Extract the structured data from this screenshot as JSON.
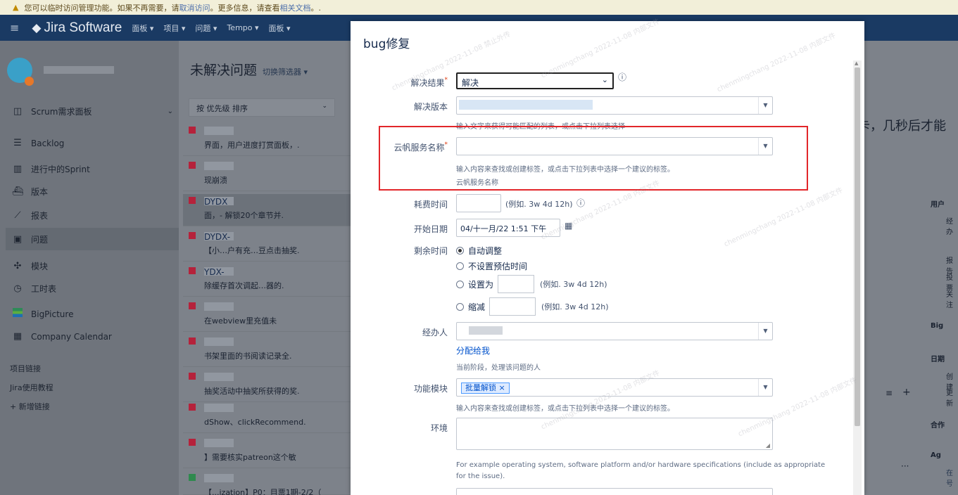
{
  "banner": {
    "text_before": "您可以临时访问管理功能。如果不再需要，请 ",
    "cancel_link": "取消访问",
    "text_middle": "。更多信息，请查看 ",
    "docs_link": "相关文档",
    "text_after": "。."
  },
  "topnav": {
    "app_name": "Jira Software",
    "items": [
      "面板 ▾",
      "项目 ▾",
      "问题 ▾",
      "Tempo ▾",
      "面板 ▾"
    ]
  },
  "sidebar": {
    "board_name": "Scrum需求面板",
    "items": [
      {
        "label": "Backlog",
        "icon": "backlog-icon"
      },
      {
        "label": "进行中的Sprint",
        "icon": "sprint-icon"
      },
      {
        "label": "版本",
        "icon": "release-icon"
      },
      {
        "label": "报表",
        "icon": "reports-icon"
      },
      {
        "label": "问题",
        "icon": "issues-icon"
      },
      {
        "label": "模块",
        "icon": "components-icon"
      },
      {
        "label": "工时表",
        "icon": "timesheet-icon"
      },
      {
        "label": "BigPicture",
        "icon": "bigpicture-icon"
      },
      {
        "label": "Company Calendar",
        "icon": "calendar-icon"
      }
    ],
    "project_links_heading": "项目链接",
    "links": [
      "Jira使用教程"
    ],
    "add_link": "+ 新增链接"
  },
  "board": {
    "title": "未解决问题",
    "switch_filter": "切换筛选器 ▾",
    "sort_label": "按 优先级 排序",
    "issues": [
      {
        "key": "",
        "text": "界面，用户进度打赏面板，."
      },
      {
        "key": "",
        "text": "现崩溃"
      },
      {
        "key": "DYDX",
        "text": "面，-  解锁20个章节并."
      },
      {
        "key": "DYDX-",
        "text": "【小…户有充…豆点击抽奖."
      },
      {
        "key": "YDX-",
        "text": "除缓存首次调起…器的."
      },
      {
        "key": "",
        "text": "在webview里充值未"
      },
      {
        "key": "",
        "text": "书架里面的书阅读记录全."
      },
      {
        "key": "",
        "text": "抽奖活动中抽奖所获得的奖."
      },
      {
        "key": "",
        "text": "dShow、clickRecommend."
      },
      {
        "key": "",
        "text": "】需要核实patreon这个敏"
      },
      {
        "key": "",
        "text": "【...ization】P0：目票1期-2/2（"
      }
    ],
    "right_text": "卡，几秒后才能",
    "right_sections": [
      "用户",
      "经办",
      "报告",
      "投票",
      "关注",
      "Big",
      "日期",
      "创建",
      "更新",
      "合作",
      "Ag",
      "在号"
    ]
  },
  "dialog": {
    "title": "bug修复",
    "resolution": {
      "label": "解决结果",
      "value": "解决"
    },
    "fix_version": {
      "label": "解决版本",
      "help": "输入文字来获得可能匹配的列表，或点击下拉列表选择"
    },
    "cloud_service": {
      "label": "云帆服务名称",
      "help": "输入内容来查找或创建标签，或点击下拉列表中选择一个建议的标签。",
      "desc": "云帆服务名称"
    },
    "time_spent": {
      "label": "耗费时间",
      "hint": "(例如. 3w 4d 12h)"
    },
    "start_date": {
      "label": "开始日期",
      "value": "04/十一月/22 1:51 下午"
    },
    "remaining": {
      "label": "剩余时间",
      "options": [
        "自动调整",
        "不设置预估时间",
        "设置为",
        "缩减"
      ],
      "selected": "自动调整",
      "hint": "(例如. 3w 4d 12h)"
    },
    "assignee": {
      "label": "经办人",
      "assign_to_me": "分配给我",
      "help": "当前阶段，处理该问题的人"
    },
    "component": {
      "label": "功能模块",
      "chip": "批量解锁",
      "help": "输入内容来查找或创建标签，或点击下拉列表中选择一个建议的标签。"
    },
    "environment": {
      "label": "环境",
      "help": "For example operating system, software platform and/or hardware specifications (include as appropriate for the issue)."
    }
  },
  "colors": {
    "highlight_box": "#e2262a",
    "nav_bg": "#1a3a63",
    "link": "#0052cc"
  }
}
